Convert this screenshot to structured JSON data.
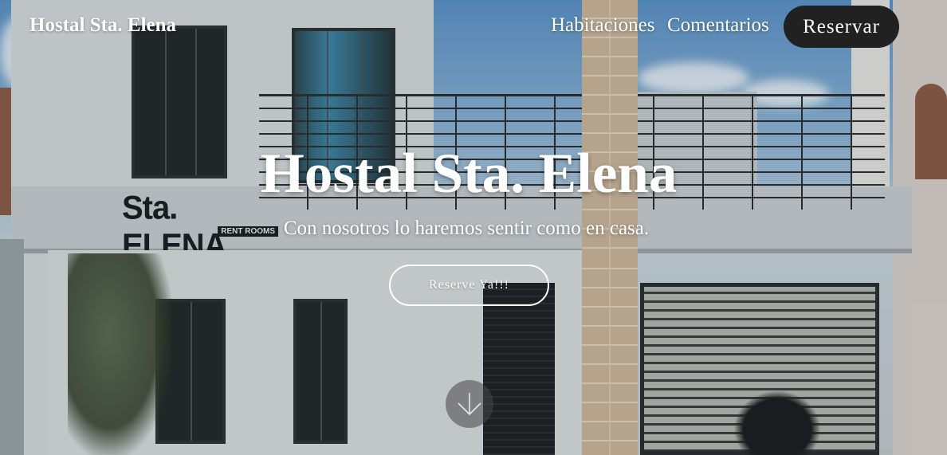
{
  "header": {
    "brand": "Hostal Sta. Elena",
    "nav": [
      {
        "label": "Habitaciones"
      },
      {
        "label": "Comentarios"
      }
    ],
    "cta_label": "Reservar"
  },
  "hero": {
    "title": "Hostal Sta. Elena",
    "subtitle": "Con nosotros lo haremos sentir como en casa.",
    "button_label": "Reserve Ya!!!",
    "scroll_icon": "arrow-down-icon"
  },
  "photo": {
    "sign_text": "Sta. ELENA",
    "sign_subtext": "RENT ROOMS"
  },
  "colors": {
    "cta_background": "#212121",
    "text": "#ffffff"
  }
}
